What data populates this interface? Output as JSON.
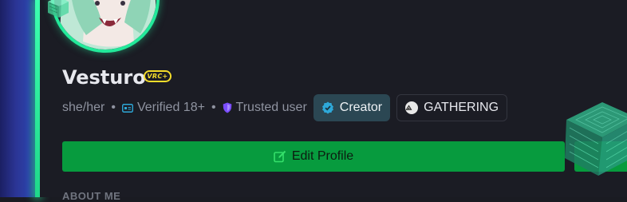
{
  "profile": {
    "display_name": "Vesturo",
    "vrc_plus_badge": "VRC+",
    "pronouns": "she/her",
    "age_verification": "Verified 18+",
    "trust_rank": "Trusted user",
    "tags": {
      "creator_label": "Creator",
      "group_label": "GATHERING"
    }
  },
  "actions": {
    "edit_profile_label": "Edit Profile"
  },
  "sections": {
    "about_me_label": "ABOUT ME"
  },
  "icons": {
    "age": "id-card-icon",
    "trust": "shield-icon",
    "creator": "verified-badge-icon",
    "group": "group-logo-icon",
    "edit": "edit-icon"
  },
  "colors": {
    "accent_green": "#079b3e",
    "glow_green": "#23e99a",
    "vrc_plus_yellow": "#f5dd2a",
    "trust_purple": "#7b4dff",
    "creator_blue": "#2ea8d8",
    "card_bg": "#1b1c24"
  }
}
